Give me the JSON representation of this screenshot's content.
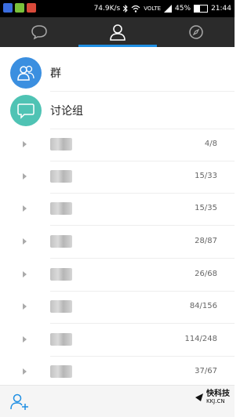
{
  "status_bar": {
    "speed": "74.9K/s",
    "network": "VOLTE",
    "battery": "45%",
    "battery_level": 0.45,
    "time": "21:44",
    "left_icon_colors": [
      "#3a6de0",
      "#7ac13a",
      "#d94a3a"
    ]
  },
  "tabs": [
    {
      "icon": "chat-bubble-icon",
      "active": false
    },
    {
      "icon": "person-icon",
      "active": true
    },
    {
      "icon": "compass-icon",
      "active": false
    }
  ],
  "colors": {
    "tab_bg": "#2b2b2b",
    "accent": "#1f8fe4",
    "qun_avatar": "#3b8fe0",
    "discuss_avatar": "#4fc3b4"
  },
  "top_items": [
    {
      "label": "群",
      "icon": "group-people-icon"
    },
    {
      "label": "讨论组",
      "icon": "discussion-bubble-icon"
    }
  ],
  "groups": [
    {
      "count": "4/8"
    },
    {
      "count": "15/33"
    },
    {
      "count": "15/35"
    },
    {
      "count": "28/87"
    },
    {
      "count": "26/68"
    },
    {
      "count": "84/156"
    },
    {
      "count": "114/248"
    },
    {
      "count": "37/67"
    }
  ],
  "bottom_bar": {
    "icon": "add-contact-icon",
    "watermark_main": "快科技",
    "watermark_sub": "KKJ.CN"
  }
}
